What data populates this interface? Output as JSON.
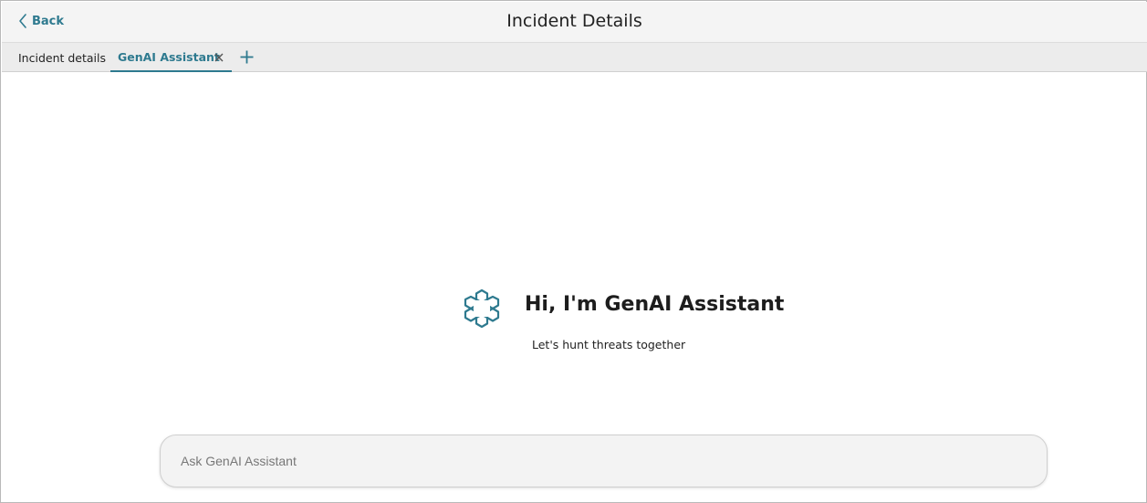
{
  "header": {
    "back_label": "Back",
    "title": "Incident Details"
  },
  "tabs": [
    {
      "label": "Incident details",
      "active": false
    },
    {
      "label": "GenAI Assistant",
      "active": true,
      "closable": true
    }
  ],
  "icons": {
    "back": "chevron-left-icon",
    "close": "close-icon",
    "add": "plus-icon",
    "assistant": "genai-assistant-icon"
  },
  "welcome": {
    "title": "Hi, I'm GenAI Assistant",
    "subtitle": "Let's hunt threats together"
  },
  "input": {
    "value": "",
    "placeholder": "Ask GenAI Assistant"
  },
  "colors": {
    "accent": "#2e7a8f",
    "header_bg": "#f4f4f4",
    "tabbar_bg": "#ececec"
  }
}
